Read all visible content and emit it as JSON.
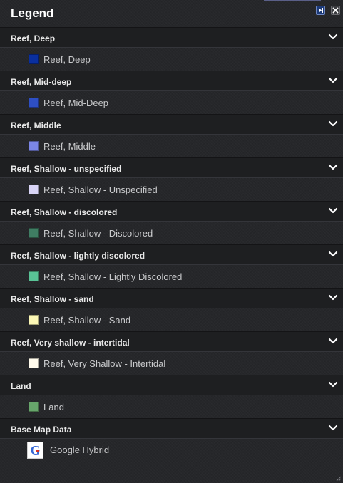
{
  "legend": {
    "title": "Legend",
    "groups": [
      {
        "title": "Reef, Deep",
        "item": {
          "label": "Reef, Deep",
          "color": "#0a2f9e"
        }
      },
      {
        "title": "Reef, Mid-deep",
        "item": {
          "label": "Reef, Mid-Deep",
          "color": "#2e4fc4"
        }
      },
      {
        "title": "Reef, Middle",
        "item": {
          "label": "Reef, Middle",
          "color": "#7b86e6"
        }
      },
      {
        "title": "Reef, Shallow - unspecified",
        "item": {
          "label": "Reef, Shallow - Unspecified",
          "color": "#d8d4f6"
        }
      },
      {
        "title": "Reef, Shallow - discolored",
        "item": {
          "label": "Reef, Shallow - Discolored",
          "color": "#3f7d63"
        }
      },
      {
        "title": "Reef, Shallow - lightly discolored",
        "item": {
          "label": "Reef, Shallow - Lightly Discolored",
          "color": "#59c396"
        }
      },
      {
        "title": "Reef, Shallow - sand",
        "item": {
          "label": "Reef, Shallow - Sand",
          "color": "#fbf7b5"
        }
      },
      {
        "title": "Reef, Very shallow - intertidal",
        "item": {
          "label": "Reef, Very Shallow - Intertidal",
          "color": "#fffbec"
        }
      },
      {
        "title": "Land",
        "item": {
          "label": "Land",
          "color": "#67a56b"
        }
      },
      {
        "title": "Base Map Data",
        "item": {
          "label": "Google Hybrid",
          "icon": "google-logo-icon"
        }
      }
    ]
  }
}
